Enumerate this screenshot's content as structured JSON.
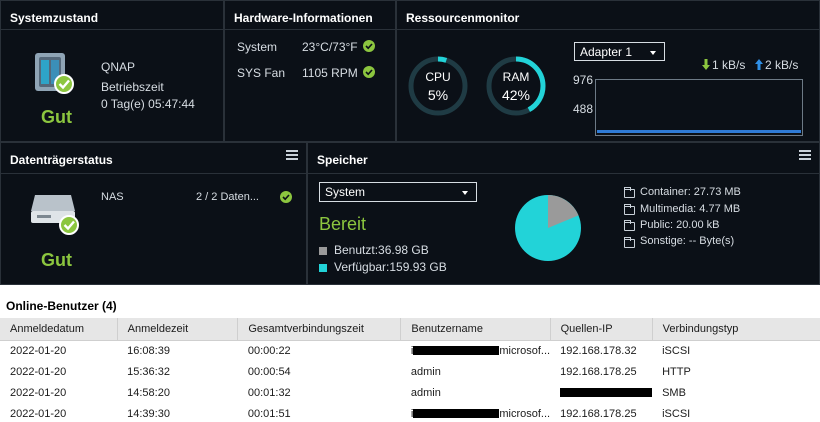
{
  "system_status": {
    "title": "Systemzustand",
    "device_name": "QNAP",
    "uptime_label": "Betriebszeit",
    "uptime_value": "0 Tag(e) 05:47:44",
    "status": "Gut"
  },
  "hardware": {
    "title": "Hardware-Informationen",
    "rows": [
      {
        "label": "System",
        "value": "23°C/73°F"
      },
      {
        "label": "SYS Fan",
        "value": "1105 RPM"
      }
    ]
  },
  "resource_monitor": {
    "title": "Ressourcenmonitor",
    "cpu": {
      "label": "CPU",
      "value_text": "5%",
      "percent": 5
    },
    "ram": {
      "label": "RAM",
      "value_text": "42%",
      "percent": 42
    },
    "adapter_select": "Adapter 1",
    "download": "1 kB/s",
    "upload": "2 kB/s",
    "chart_ticks": [
      "976",
      "488"
    ]
  },
  "disk_status": {
    "title": "Datenträgerstatus",
    "name": "NAS",
    "count": "2 / 2 Daten...",
    "status": "Gut"
  },
  "storage": {
    "title": "Speicher",
    "select": "System",
    "status": "Bereit",
    "used": "Benutzt:36.98 GB",
    "available": "Verfügbar:159.93 GB",
    "used_gb": 36.98,
    "available_gb": 159.93,
    "folders": [
      "Container: 27.73 MB",
      "Multimedia: 4.77 MB",
      "Public: 20.00 kB",
      "Sonstige: -- Byte(s)"
    ]
  },
  "online_users": {
    "title": "Online-Benutzer (4)",
    "columns": [
      "Anmeldedatum",
      "Anmeldezeit",
      "Gesamtverbindungszeit",
      "Benutzername",
      "Quellen-IP",
      "Verbindungstyp"
    ],
    "rows": [
      {
        "date": "2022-01-20",
        "time": "16:08:39",
        "total": "00:00:22",
        "user_prefix": "i",
        "user_suffix": "microsof...",
        "user_redacted": true,
        "ip": "192.168.178.32",
        "ip_redacted": false,
        "type": "iSCSI"
      },
      {
        "date": "2022-01-20",
        "time": "15:36:32",
        "total": "00:00:54",
        "user": "admin",
        "user_redacted": false,
        "ip": "192.168.178.25",
        "ip_redacted": false,
        "type": "HTTP"
      },
      {
        "date": "2022-01-20",
        "time": "14:58:20",
        "total": "00:01:32",
        "user": "admin",
        "user_redacted": false,
        "ip": "",
        "ip_redacted": true,
        "type": "SMB"
      },
      {
        "date": "2022-01-20",
        "time": "14:39:30",
        "total": "00:01:51",
        "user_prefix": "i",
        "user_suffix": "microsof...",
        "user_redacted": true,
        "ip": "192.168.178.25",
        "ip_redacted": false,
        "type": "iSCSI"
      }
    ]
  },
  "colors": {
    "panel_bg": "#0b1017",
    "accent_good": "#8cc63f",
    "gauge_cyan": "#22d3d8",
    "gauge_track": "#1f3b44",
    "used_gray": "#9a9a9a",
    "available_cyan": "#22d3d8",
    "chart_line": "#2f7bd6"
  }
}
